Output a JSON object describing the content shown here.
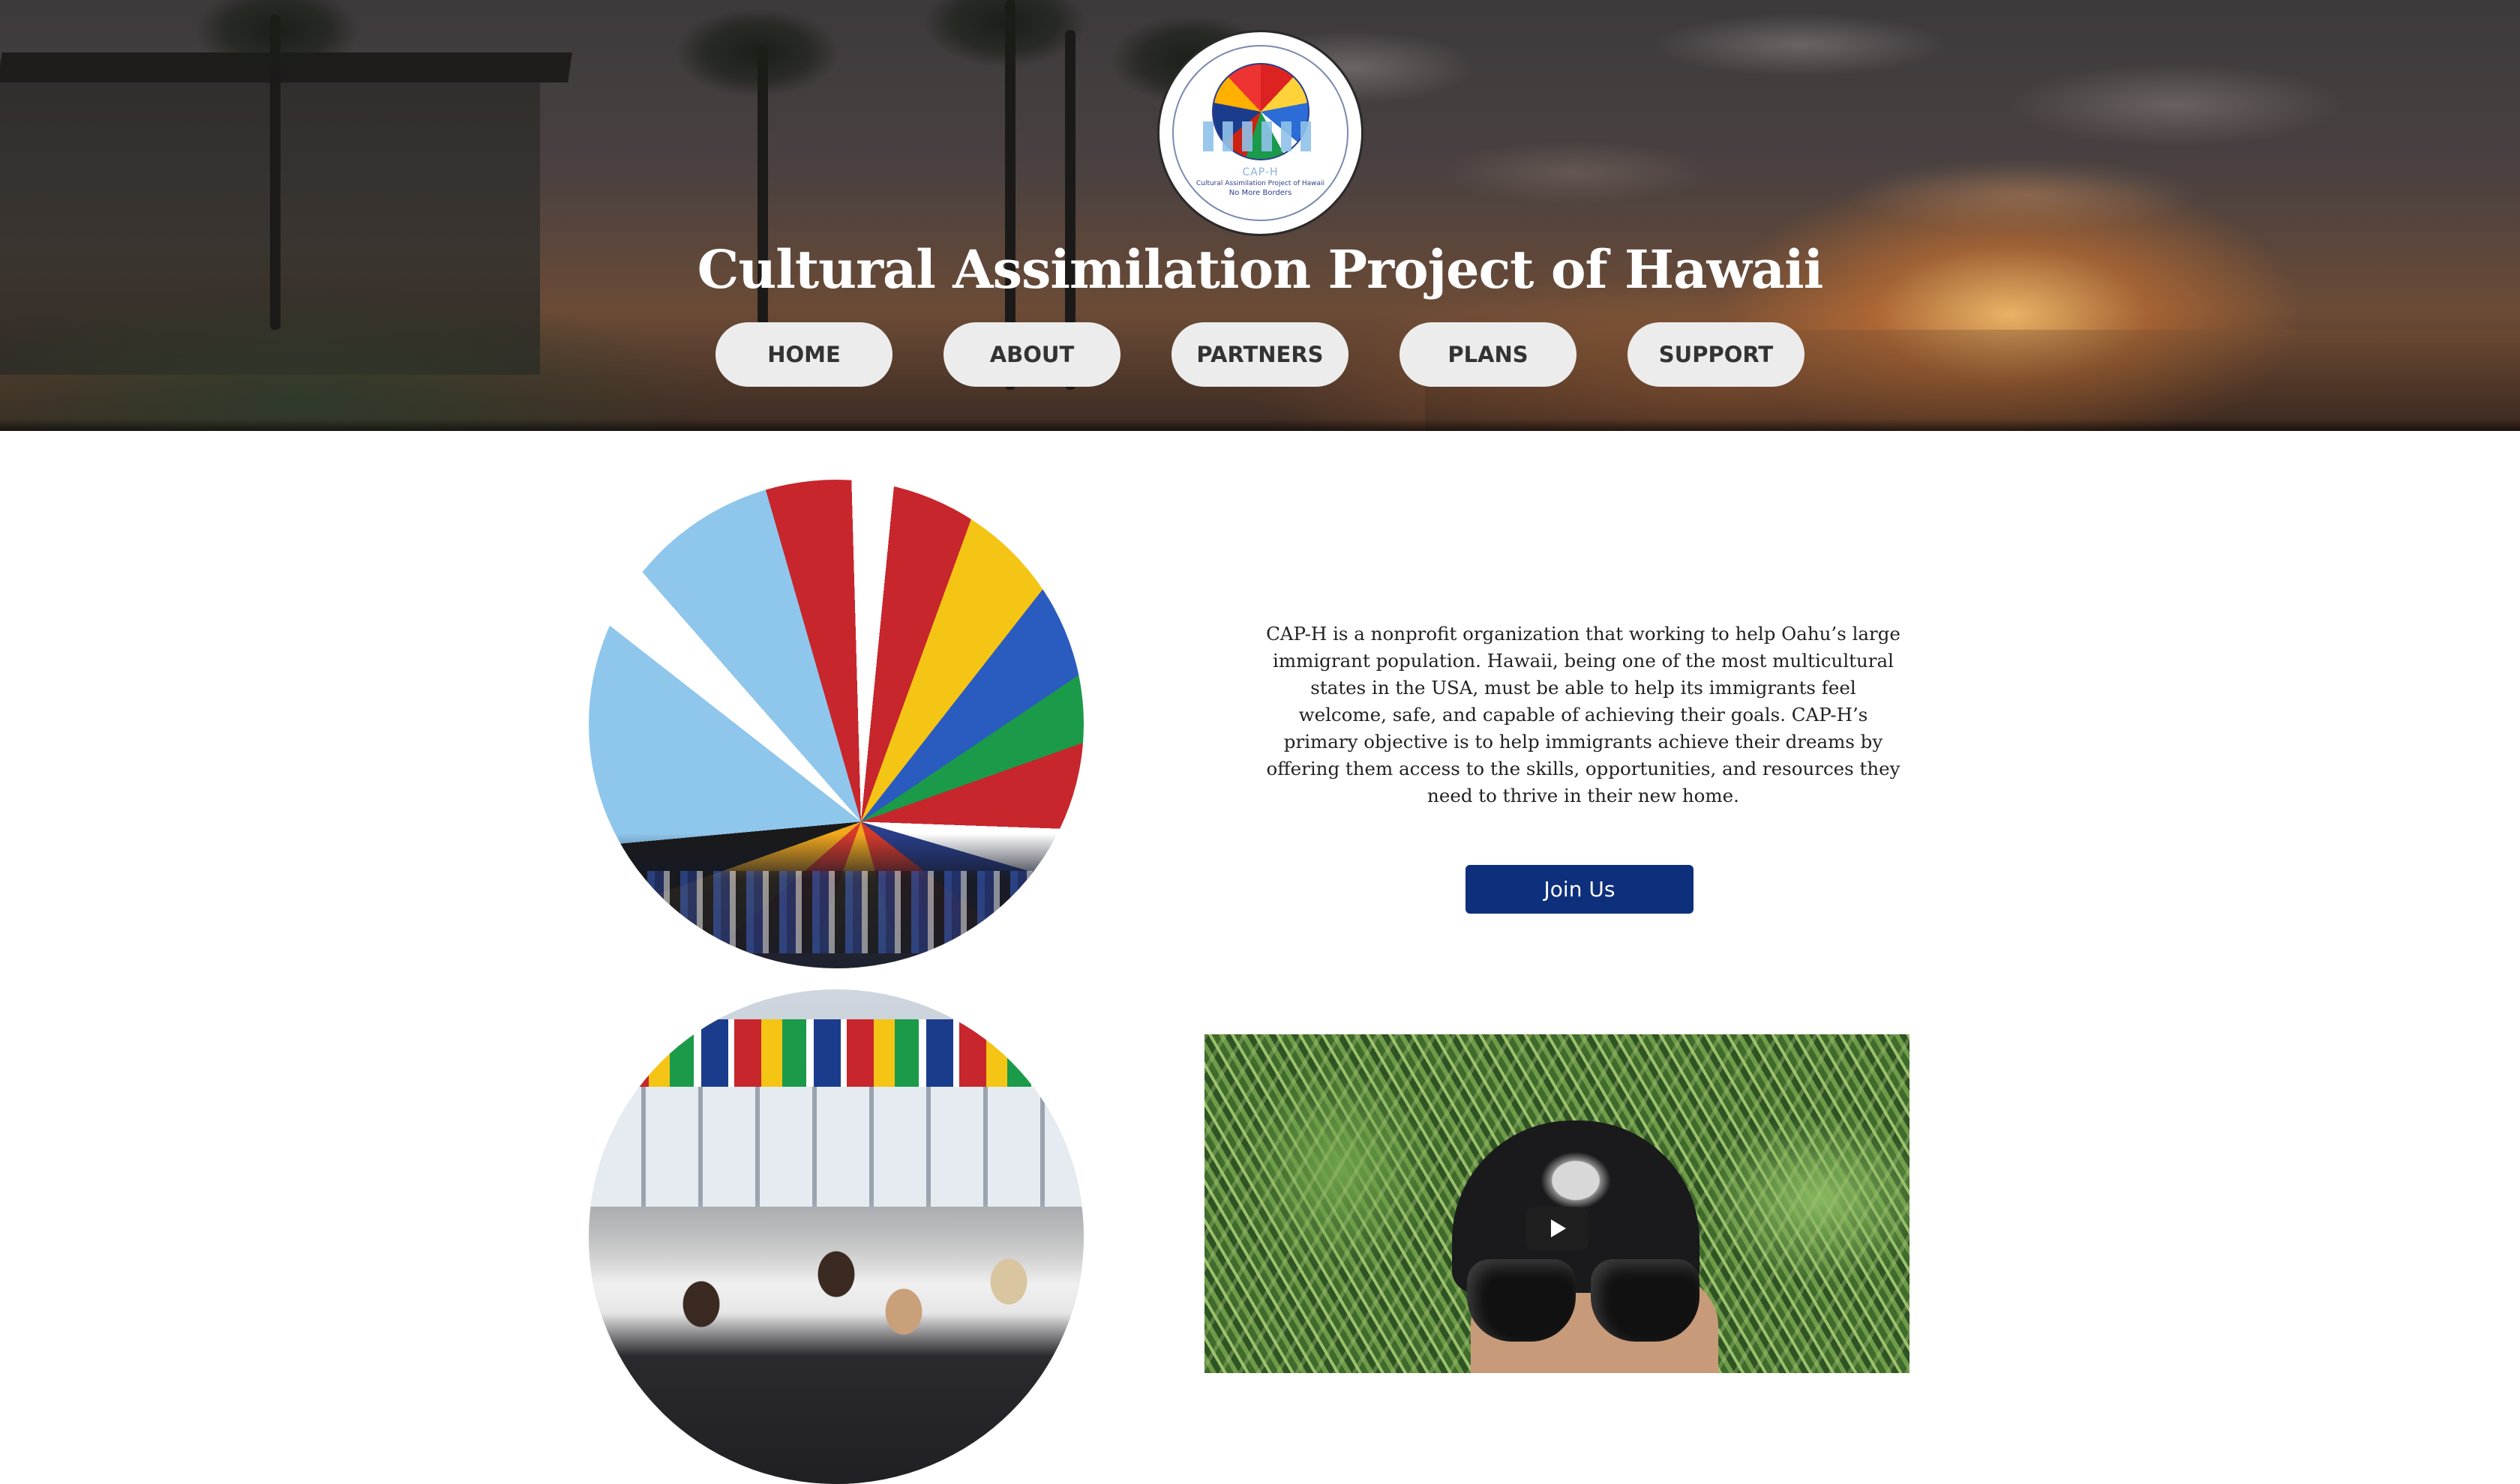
{
  "site": {
    "title": "Cultural Assimilation Project of Hawaii"
  },
  "logo": {
    "acronym": "CAP-H",
    "full_name": "Cultural Assimilation Project of Hawaii",
    "tagline": "No More Borders"
  },
  "nav": {
    "items": [
      {
        "label": "HOME"
      },
      {
        "label": "ABOUT"
      },
      {
        "label": "PARTNERS"
      },
      {
        "label": "PLANS"
      },
      {
        "label": "SUPPORT"
      }
    ]
  },
  "about": {
    "text": "CAP-H is a nonprofit organization that working to help Oahu’s large immigrant population. Hawaii, being one of the most multicultural states in the USA, must be able to help its immigrants feel welcome, safe, and capable of achieving their goals. CAP-H’s primary objective is to help immigrants achieve their dreams by offering them access to the skills, opportunities, and resources they need to thrive in their new home.",
    "join_label": "Join Us"
  },
  "colors": {
    "join_button": "#0e2f7c",
    "nav_button_bg": "#ececec",
    "nav_button_text": "#333333",
    "title_text": "#ffffff"
  },
  "icons": {
    "play": "play-icon"
  }
}
